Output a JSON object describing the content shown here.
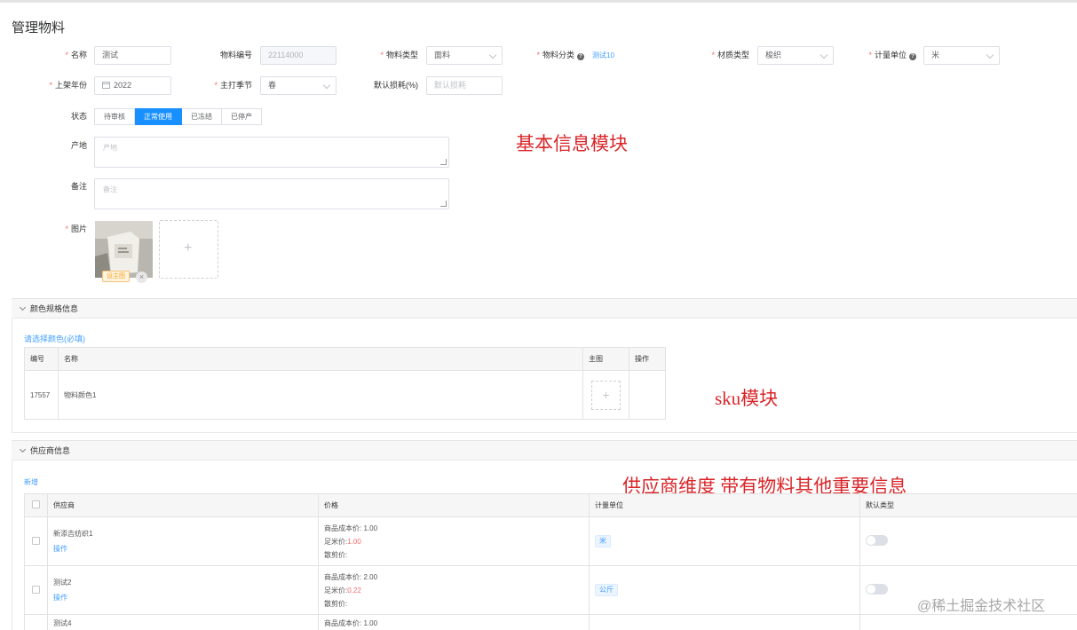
{
  "page": {
    "title": "管理物料"
  },
  "form": {
    "name": {
      "label": "名称",
      "value": "测试"
    },
    "code": {
      "label": "物料编号",
      "value": "22114000"
    },
    "type": {
      "label": "物料类型",
      "value": "面料"
    },
    "category": {
      "label": "物料分类",
      "value": "测试10"
    },
    "material": {
      "label": "材质类型",
      "value": "梭织"
    },
    "unit": {
      "label": "计量单位",
      "value": "米"
    },
    "year": {
      "label": "上架年份",
      "value": "2022"
    },
    "season": {
      "label": "主打季节",
      "value": "春"
    },
    "loss": {
      "label": "默认损耗(%)",
      "placeholder": "默认损耗"
    },
    "status": {
      "label": "状态",
      "options": [
        "待审核",
        "正常使用",
        "已冻结",
        "已停产"
      ],
      "selected": "正常使用"
    },
    "origin": {
      "label": "产地",
      "placeholder": "产地"
    },
    "remark": {
      "label": "备注",
      "placeholder": "备注"
    },
    "image": {
      "label": "图片",
      "badge": "设主图",
      "add_icon": "plus-icon"
    }
  },
  "annotations": {
    "basic": "基本信息模块",
    "sku": "sku模块",
    "supplier": "供应商维度  带有物料其他重要信息"
  },
  "color_section": {
    "title": "颜色规格信息",
    "choose_link": "请选择颜色(必填)",
    "columns": [
      "编号",
      "名称",
      "主图",
      "操作"
    ],
    "rows": [
      {
        "id": "17557",
        "name": "物料颜色1"
      }
    ]
  },
  "supplier_section": {
    "title": "供应商信息",
    "add_link": "新增",
    "columns": [
      "供应商",
      "价格",
      "计量单位",
      "默认类型"
    ],
    "rows": [
      {
        "name": "新添吉纺织1",
        "action": "操作",
        "cost": "商品成本价: 1.00",
        "meter_label": "足米价:",
        "meter_value": "1.00",
        "bulk": "散剪价:",
        "unit": "米"
      },
      {
        "name": "测试2",
        "action": "操作",
        "cost": "商品成本价: 2.00",
        "meter_label": "足米价:",
        "meter_value": "0.22",
        "bulk": "散剪价:",
        "unit": "公斤"
      },
      {
        "name": "测试4",
        "action": "",
        "cost": "商品成本价: 1.00",
        "meter_label": "",
        "meter_value": "",
        "bulk": "",
        "unit": ""
      }
    ]
  },
  "watermark": "@稀土掘金技术社区",
  "colors": {
    "accent": "#1890ff",
    "required": "#f56c6c",
    "annotation": "#d9262a"
  }
}
